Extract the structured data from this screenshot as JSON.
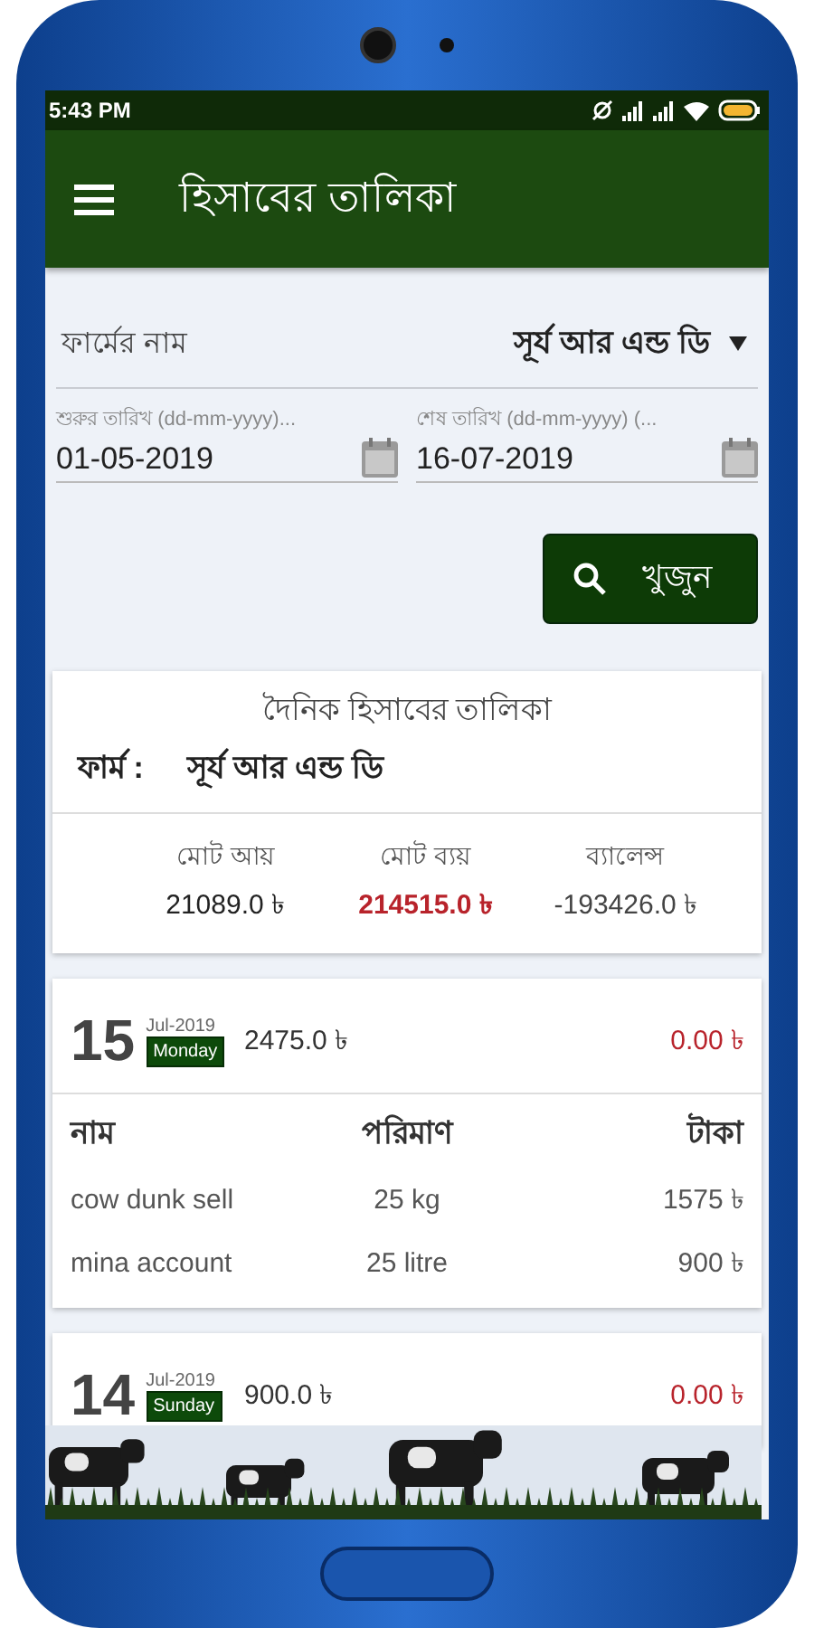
{
  "status_bar": {
    "time": "5:43 PM"
  },
  "app_bar": {
    "title": "হিসাবের তালিকা"
  },
  "farm_field": {
    "label": "ফার্মের নাম",
    "value": "সূর্য আর এন্ড ডি"
  },
  "date_fields": [
    {
      "label": "শুরুর তারিখ (dd-mm-yyyy)...",
      "value": "01-05-2019"
    },
    {
      "label": "শেষ তারিখ (dd-mm-yyyy) (...",
      "value": "16-07-2019"
    }
  ],
  "search_button": {
    "label": "খুজুন"
  },
  "summary": {
    "title": "দৈনিক হিসাবের তালিকা",
    "farm_label": "ফার্ম :",
    "farm_name": "সূর্য আর এন্ড ডি",
    "totals": [
      {
        "kind": "income",
        "label": "মোট আয়",
        "value": "21089.0 ৳"
      },
      {
        "kind": "expense",
        "label": "মোট ব্যয়",
        "value": "214515.0 ৳"
      },
      {
        "kind": "balance",
        "label": "ব্যালেন্স",
        "value": "-193426.0 ৳"
      }
    ]
  },
  "days": [
    {
      "day": "15",
      "month": "Jul-2019",
      "weekday": "Monday",
      "income": "2475.0 ৳",
      "expense": "0.00 ৳",
      "columns": [
        "নাম",
        "পরিমাণ",
        "টাকা"
      ],
      "items": [
        {
          "name": "cow dunk sell",
          "quantity": "25 kg",
          "amount": "1575 ৳"
        },
        {
          "name": "mina account",
          "quantity": "25 litre",
          "amount": "900 ৳"
        }
      ]
    },
    {
      "day": "14",
      "month": "Jul-2019",
      "weekday": "Sunday",
      "income": "900.0 ৳",
      "expense": "0.00 ৳"
    }
  ]
}
